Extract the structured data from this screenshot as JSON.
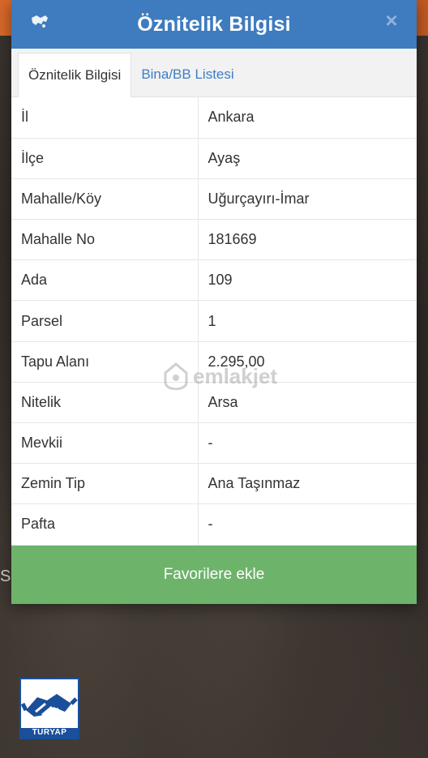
{
  "dialog": {
    "title": "Öznitelik Bilgisi",
    "close_label": "×"
  },
  "tabs": [
    {
      "label": "Öznitelik Bilgisi",
      "active": true
    },
    {
      "label": "Bina/BB Listesi",
      "active": false
    }
  ],
  "attributes": [
    {
      "key": "İl",
      "value": "Ankara"
    },
    {
      "key": "İlçe",
      "value": "Ayaş"
    },
    {
      "key": "Mahalle/Köy",
      "value": "Uğurçayırı-İmar"
    },
    {
      "key": "Mahalle No",
      "value": "181669"
    },
    {
      "key": "Ada",
      "value": "109"
    },
    {
      "key": "Parsel",
      "value": "1"
    },
    {
      "key": "Tapu Alanı",
      "value": "2.295,00"
    },
    {
      "key": "Nitelik",
      "value": "Arsa"
    },
    {
      "key": "Mevkii",
      "value": "-"
    },
    {
      "key": "Zemin Tip",
      "value": "Ana Taşınmaz"
    },
    {
      "key": "Pafta",
      "value": "-"
    }
  ],
  "favorite_button": "Favorilere ekle",
  "watermark": "emlakjet",
  "logo": "TURYAP",
  "background_edge_text": "S",
  "colors": {
    "header": "#3e7bbf",
    "tab_link": "#3d7fc4",
    "favorite": "#6db36a"
  }
}
